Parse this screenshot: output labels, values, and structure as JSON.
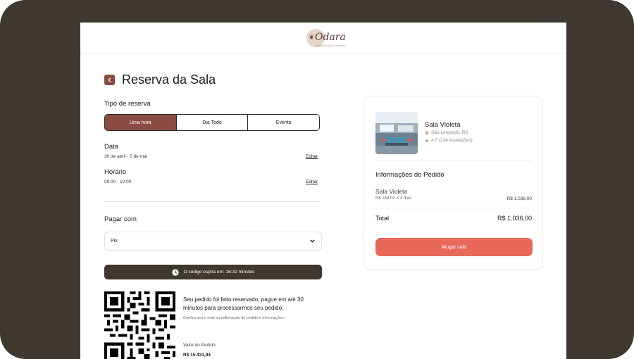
{
  "brand": {
    "logo_text": "Odara",
    "tagline": "ESPAÇOS PARA EVENTOS",
    "accent": "#8b4a42",
    "cta_color": "#e8695a",
    "dark": "#3f3831"
  },
  "header": {
    "title": "Reserva da Sala",
    "back_icon": "chevron-left-icon"
  },
  "booking_type": {
    "label": "Tipo de reserva",
    "options": [
      "Uma hora",
      "Dia Todo",
      "Evento"
    ],
    "selected": "Uma hora"
  },
  "date": {
    "label": "Data",
    "value": "30 de abril - 5 de mai",
    "edit_label": "Editar"
  },
  "time": {
    "label": "Horário",
    "value": "09:00 - 10:00",
    "edit_label": "Editar"
  },
  "payment": {
    "label": "Pagar com",
    "selected": "Pix",
    "timer_icon": "clock-icon",
    "timer_text": "O código espira em: 16:32 minutos",
    "message": "Seu pedido foi feito reservado, pague em até 30 minutos para processarmos seu pedido.",
    "sub_message": "Confira seu e-mail a confirmação do pedido e informações.",
    "order_value_label": "Valor do Pedido",
    "order_value": "R$ 15.431,94"
  },
  "summary": {
    "room_name": "Sala Violeta",
    "location": "São Leopoldo, RS",
    "rating": "4.7 (234 Avaliações)",
    "section_title": "Informações do Pedido",
    "item_name": "Sala Violeta",
    "item_calc": "R$ 259,00 X 4 dias",
    "item_price": "R$ 1.036,00",
    "total_label": "Total",
    "total_value": "R$ 1.036,00",
    "cta_label": "Alugar sala"
  }
}
